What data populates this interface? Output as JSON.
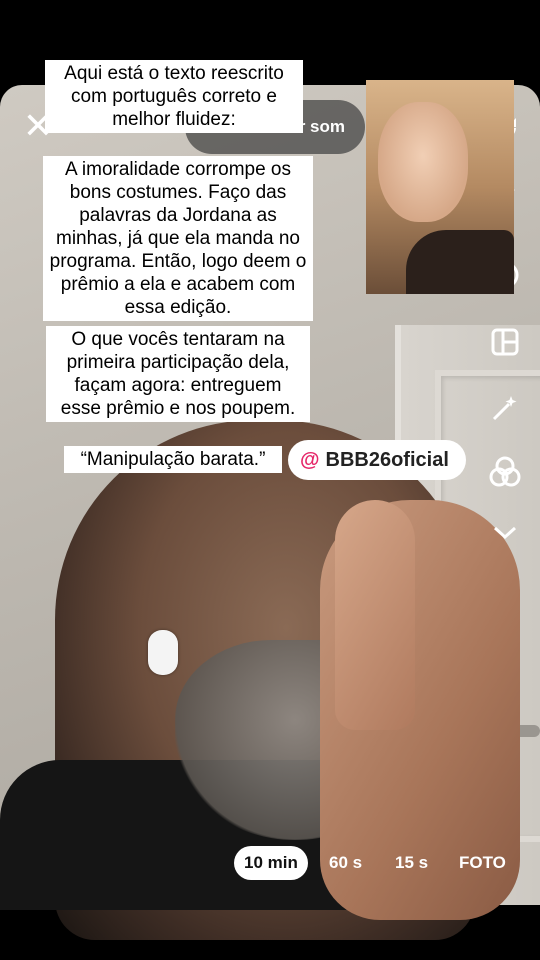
{
  "header": {
    "sound_label": "cionar som"
  },
  "captions": {
    "intro": "Aqui está o texto reescrito com português correto e melhor fluidez:",
    "paragraph1": "A imoralidade corrompe os bons costumes. Faço das palavras da Jordana as minhas, já que ela manda no programa. Então, logo deem o prêmio a ela e acabem com essa edição.",
    "paragraph2": "O que vocês tentaram na primeira participação dela, façam agora: entreguem esse prêmio e nos poupem.",
    "quote": "“Manipulação barata.”"
  },
  "mention": {
    "at": "@",
    "handle": "BBB26oficial"
  },
  "modes": [
    "10 min",
    "60 s",
    "15 s",
    "FOTO"
  ],
  "active_mode": "10 min",
  "icons": [
    "close-icon",
    "flip-camera-icon",
    "speed-icon",
    "timer-icon",
    "layout-icon",
    "beauty-icon",
    "filters-icon",
    "chevron-down-icon"
  ],
  "colors": {
    "mention_at": "#e6286a",
    "caption_bg": "#ffffff"
  }
}
